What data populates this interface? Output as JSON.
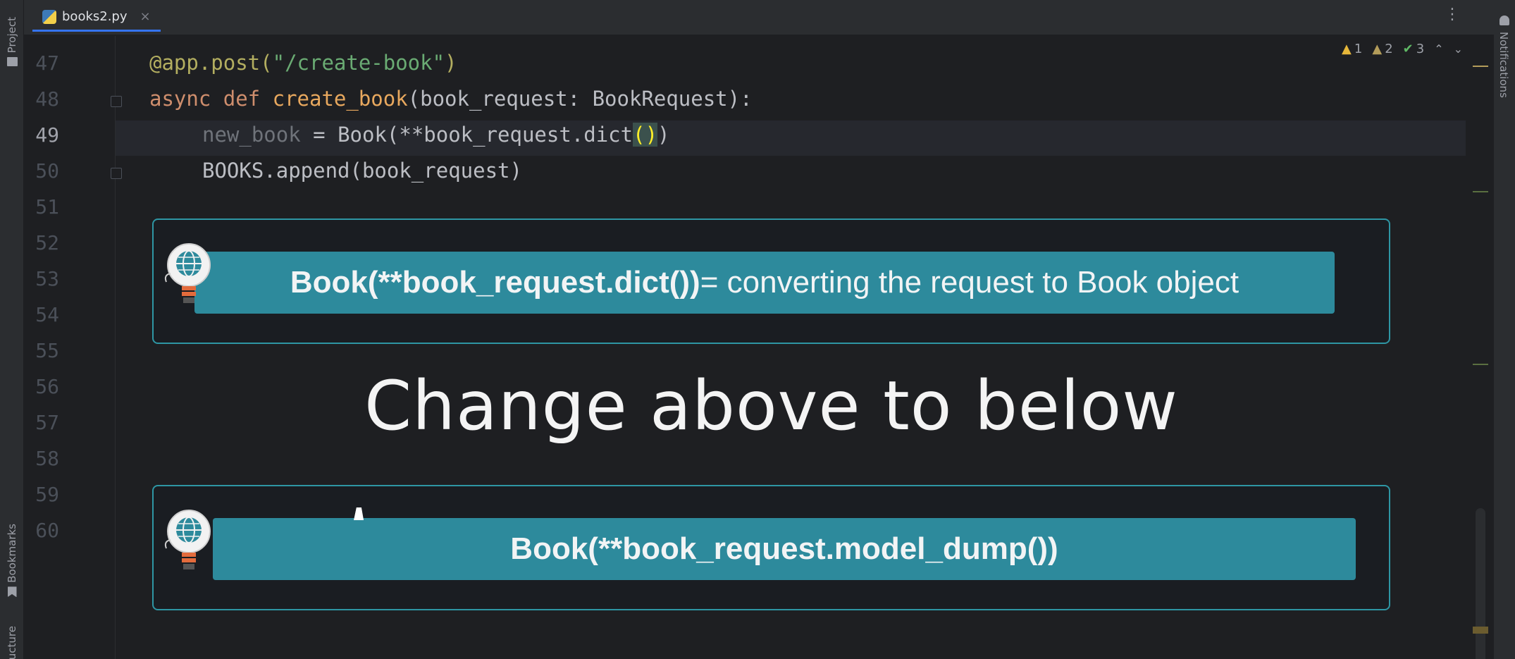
{
  "window": {
    "left_tools": [
      "Project",
      "Bookmarks",
      "Structure"
    ],
    "right_tools": [
      "Notifications"
    ]
  },
  "tab": {
    "filename": "books2.py",
    "close": "×",
    "icon": "python-file-icon"
  },
  "inspections": {
    "warnings": "1",
    "weak_warnings": "2",
    "typos": "3"
  },
  "editor": {
    "current_line": "49",
    "lines": [
      "47",
      "48",
      "49",
      "50",
      "51",
      "52",
      "53",
      "54",
      "55",
      "56",
      "57",
      "58",
      "59",
      "60"
    ],
    "code": {
      "l47_dec": "@app.post(",
      "l47_str": "\"/create-book\"",
      "l47_end": ")",
      "l48_kw": "async def ",
      "l48_fn": "create_book",
      "l48_rest": "(book_request: BookRequest):",
      "l49_dim": "new_book",
      "l49_mid": " = Book(**book_request.dict",
      "l49_open": "(",
      "l49_close": ")",
      "l49_end": ")",
      "l50": "BOOKS.append(book_request)"
    }
  },
  "overlay": {
    "top_banner_bold": "Book(**book_request.dict())",
    "top_banner_rest": " = converting the request to Book object",
    "headline": "Change above to below",
    "bottom_banner": "Book(**book_request.model_dump())",
    "bulb_icon": "lightbulb-globe-icon"
  }
}
